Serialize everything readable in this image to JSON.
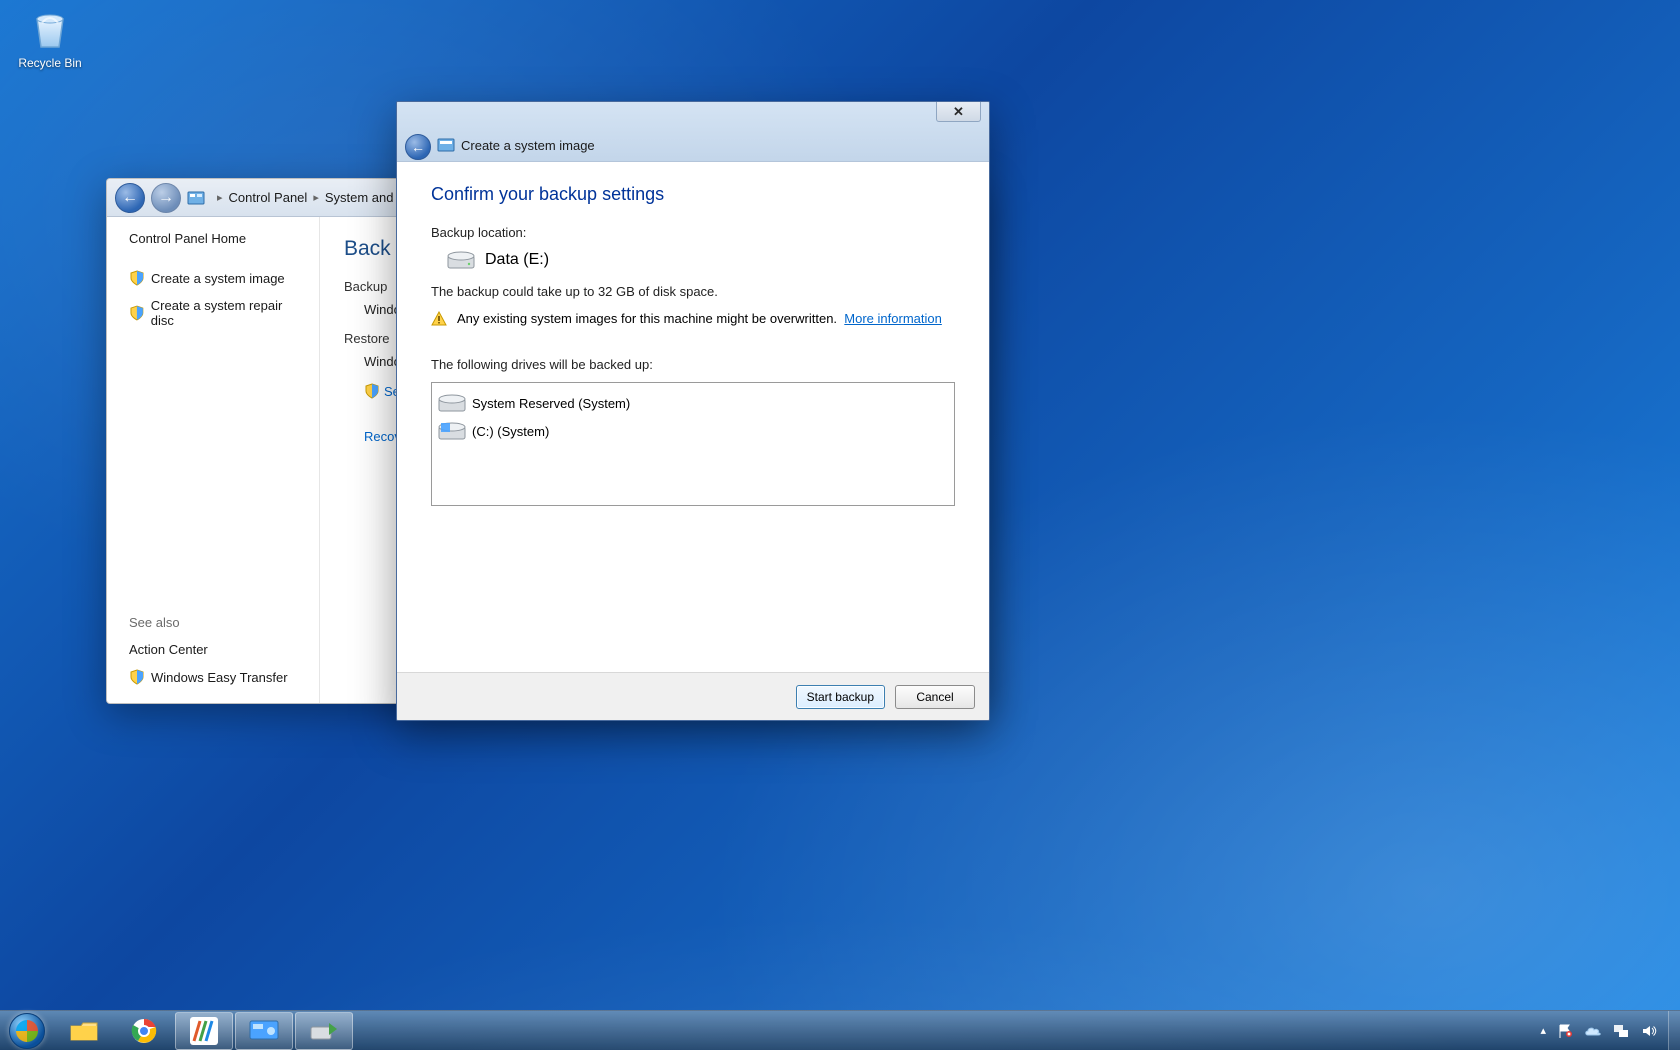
{
  "desktop": {
    "recycle_bin_label": "Recycle Bin"
  },
  "control_panel": {
    "breadcrumb": {
      "root": "Control Panel",
      "level2": "System and Se"
    },
    "home_label": "Control Panel Home",
    "side_items": {
      "create_image": "Create a system image",
      "create_repair": "Create a system repair disc"
    },
    "see_also_label": "See also",
    "see_also": {
      "action_center": "Action Center",
      "easy_transfer": "Windows Easy Transfer"
    },
    "main": {
      "heading": "Back up",
      "section_backup": "Backup",
      "backup_indent": "Windo",
      "section_restore": "Restore",
      "restore_indent": "Windo",
      "select_link": "Sel",
      "recover_link": "Recov"
    }
  },
  "wizard": {
    "title": "Create a system image",
    "heading": "Confirm your backup settings",
    "backup_location_label": "Backup location:",
    "backup_location_value": "Data (E:)",
    "size_estimate": "The backup could take up to 32 GB of disk space.",
    "overwrite_warning": "Any existing system images for this machine might be overwritten.",
    "more_info": "More information",
    "drives_label": "The following drives will be backed up:",
    "drives": [
      {
        "label": "System Reserved (System)"
      },
      {
        "label": "(C:) (System)"
      }
    ],
    "buttons": {
      "start": "Start backup",
      "cancel": "Cancel"
    }
  },
  "taskbar": {
    "items": [
      "file-explorer",
      "chrome",
      "app-colorful",
      "control-panel",
      "backup-wizard"
    ]
  }
}
